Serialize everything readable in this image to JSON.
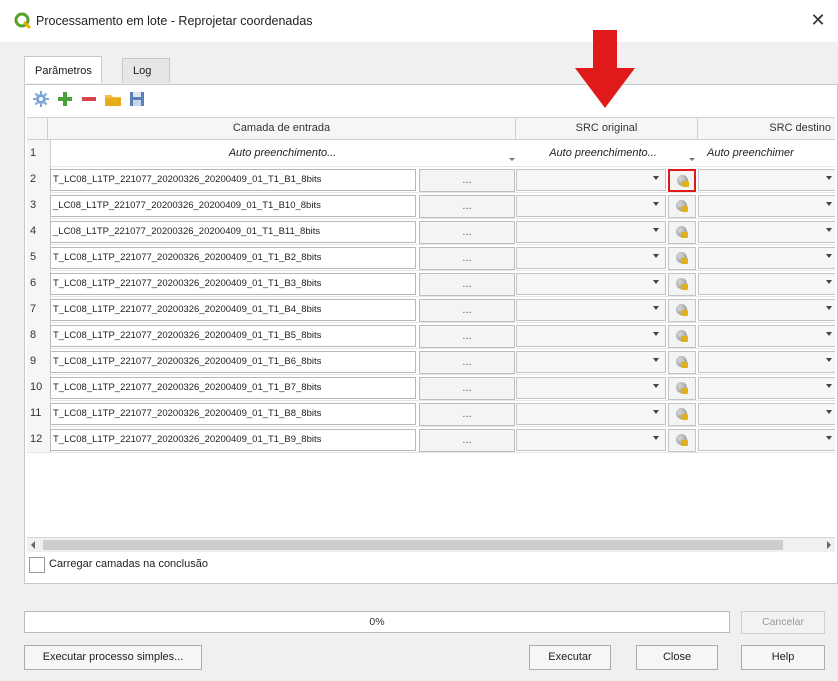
{
  "window": {
    "title": "Processamento em lote - Reprojetar coordenadas",
    "close": "✕"
  },
  "tabs": [
    {
      "label": "Parâmetros"
    },
    {
      "label": "Log"
    }
  ],
  "toolbar": {
    "icons": [
      "gear-icon",
      "add-row-icon",
      "remove-row-icon",
      "open-folder-icon",
      "save-icon"
    ]
  },
  "columns": {
    "input": "Camada de entrada",
    "src_orig": "SRC original",
    "src_dest": "SRC destino"
  },
  "autofill": {
    "row_num": "1",
    "input": "Auto preenchimento...",
    "src_orig": "Auto preenchimento...",
    "src_dest": "Auto preenchimer"
  },
  "rows": [
    {
      "num": "2",
      "value": "T_LC08_L1TP_221077_20200326_20200409_01_T1_B1_8bits",
      "browse": "..."
    },
    {
      "num": "3",
      "value": "_LC08_L1TP_221077_20200326_20200409_01_T1_B10_8bits",
      "browse": "..."
    },
    {
      "num": "4",
      "value": "_LC08_L1TP_221077_20200326_20200409_01_T1_B11_8bits",
      "browse": "..."
    },
    {
      "num": "5",
      "value": "T_LC08_L1TP_221077_20200326_20200409_01_T1_B2_8bits",
      "browse": "..."
    },
    {
      "num": "6",
      "value": "T_LC08_L1TP_221077_20200326_20200409_01_T1_B3_8bits",
      "browse": "..."
    },
    {
      "num": "7",
      "value": "T_LC08_L1TP_221077_20200326_20200409_01_T1_B4_8bits",
      "browse": "..."
    },
    {
      "num": "8",
      "value": "T_LC08_L1TP_221077_20200326_20200409_01_T1_B5_8bits",
      "browse": "..."
    },
    {
      "num": "9",
      "value": "T_LC08_L1TP_221077_20200326_20200409_01_T1_B6_8bits",
      "browse": "..."
    },
    {
      "num": "10",
      "value": "T_LC08_L1TP_221077_20200326_20200409_01_T1_B7_8bits",
      "browse": "..."
    },
    {
      "num": "11",
      "value": "T_LC08_L1TP_221077_20200326_20200409_01_T1_B8_8bits",
      "browse": "..."
    },
    {
      "num": "12",
      "value": "T_LC08_L1TP_221077_20200326_20200409_01_T1_B9_8bits",
      "browse": "..."
    }
  ],
  "load_layers_label": "Carregar camadas na conclusão",
  "progress_text": "0%",
  "progress_value": 0,
  "buttons": {
    "cancel": "Cancelar",
    "single": "Executar processo simples...",
    "run": "Executar",
    "close": "Close",
    "help": "Help"
  },
  "colors": {
    "highlight": "#e0191b",
    "annotation_arrow": "#e0191b",
    "qgis_green": "#5aa02c"
  }
}
